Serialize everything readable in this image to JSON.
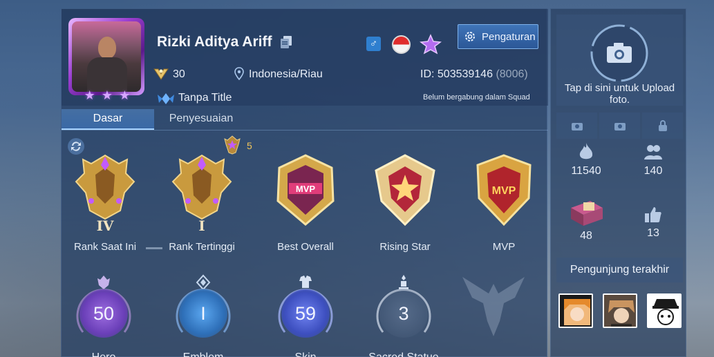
{
  "profile": {
    "name": "Rizki Aditya Ariff",
    "level": "30",
    "location": "Indonesia/Riau",
    "title": "Tanpa Title",
    "id_label": "ID: 503539146",
    "id_sub": "(8006)",
    "squad_status": "Belum bergabung dalam Squad",
    "gender_symbol": "♂",
    "avatar_stars": [
      "★",
      "★",
      "★"
    ]
  },
  "header": {
    "settings_label": "Pengaturan"
  },
  "tabs": [
    {
      "label": "Dasar",
      "active": true
    },
    {
      "label": "Penyesuaian",
      "active": false
    }
  ],
  "medals": [
    {
      "label": "Rank Saat Ini",
      "numeral": "IV",
      "icon": "mythic-rank-medal-icon"
    },
    {
      "label": "Rank Tertinggi",
      "numeral": "I",
      "icon": "mythic-rank-medal-icon"
    },
    {
      "label": "Best Overall",
      "icon": "mvp-crest-icon"
    },
    {
      "label": "Rising Star",
      "icon": "rising-star-crest-icon"
    },
    {
      "label": "MVP",
      "icon": "mvp-shield-icon"
    }
  ],
  "highest_rank_stars": "5",
  "stats": [
    {
      "label": "Hero",
      "value": "50",
      "icon": "hero-icon",
      "color": "#b98cf0"
    },
    {
      "label": "Emblem",
      "value": "I",
      "icon": "emblem-icon",
      "color": "#7fb6f2"
    },
    {
      "label": "Skin",
      "value": "59",
      "icon": "skin-icon",
      "color": "#9fb0ff"
    },
    {
      "label": "Sacred Statue",
      "value": "3",
      "icon": "statue-icon",
      "color": "#c9d3e3"
    }
  ],
  "right_panel": {
    "upload_text": "Tap di sini untuk Upload foto.",
    "popularity": "11540",
    "followers": "140",
    "gifts": "48",
    "likes": "13",
    "visitors_label": "Pengunjung terakhir"
  },
  "colors": {
    "accent": "#3f74b8",
    "gold": "#f0c45a",
    "panel": "#263e62"
  }
}
